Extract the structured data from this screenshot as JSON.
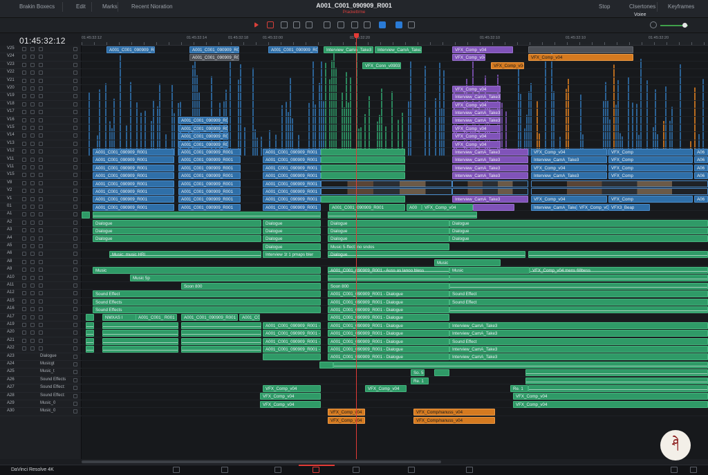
{
  "window": {
    "menu": [
      "Brakin Boxecs",
      "Edit",
      "Marks",
      "Recent Nioration"
    ],
    "title": "A001_C001_090909_R001",
    "subtitle": "Prackettrme",
    "right_menu": [
      "Stop",
      "Clsertones",
      "Keyframes"
    ],
    "right_label": "Voiee"
  },
  "timecode": "01:45:32:12",
  "ruler_labels": [
    "01:45:32:12",
    "01:45:32:14",
    "01:45:32:18",
    "01:45:32:00",
    "01:45:32:20",
    "01:45:32:10",
    "01:45:32:10",
    "01:45:32:20"
  ],
  "tracks": [
    {
      "name": "V25",
      "label": ""
    },
    {
      "name": "V24",
      "label": ""
    },
    {
      "name": "V23",
      "label": ""
    },
    {
      "name": "V22",
      "label": ""
    },
    {
      "name": "V21",
      "label": ""
    },
    {
      "name": "V20",
      "label": ""
    },
    {
      "name": "V19",
      "label": ""
    },
    {
      "name": "V18",
      "label": ""
    },
    {
      "name": "V17",
      "label": ""
    },
    {
      "name": "V16",
      "label": ""
    },
    {
      "name": "V15",
      "label": ""
    },
    {
      "name": "V14",
      "label": ""
    },
    {
      "name": "V13",
      "label": ""
    },
    {
      "name": "V12",
      "label": ""
    },
    {
      "name": "V11",
      "label": ""
    },
    {
      "name": "V11",
      "label": ""
    },
    {
      "name": "V15",
      "label": ""
    },
    {
      "name": "V8",
      "label": ""
    },
    {
      "name": "V2",
      "label": ""
    },
    {
      "name": "V1",
      "label": ""
    },
    {
      "name": "01",
      "label": ""
    },
    {
      "name": "A1",
      "label": ""
    },
    {
      "name": "A2",
      "label": ""
    },
    {
      "name": "A3",
      "label": ""
    },
    {
      "name": "A4",
      "label": ""
    },
    {
      "name": "A5",
      "label": ""
    },
    {
      "name": "A6",
      "label": ""
    },
    {
      "name": "A8",
      "label": ""
    },
    {
      "name": "A9",
      "label": ""
    },
    {
      "name": "A10",
      "label": ""
    },
    {
      "name": "A11",
      "label": ""
    },
    {
      "name": "A12",
      "label": ""
    },
    {
      "name": "A15",
      "label": ""
    },
    {
      "name": "A16",
      "label": ""
    },
    {
      "name": "A17",
      "label": ""
    },
    {
      "name": "A19",
      "label": ""
    },
    {
      "name": "A20",
      "label": ""
    },
    {
      "name": "A21",
      "label": ""
    },
    {
      "name": "A22",
      "label": ""
    },
    {
      "name": "A23",
      "label": "Dialogue"
    },
    {
      "name": "A24",
      "label": "Musicgt"
    },
    {
      "name": "A25",
      "label": "Music_t"
    },
    {
      "name": "A26",
      "label": "Sound Effects"
    },
    {
      "name": "A27",
      "label": "Sound Effect:"
    },
    {
      "name": "A28",
      "label": "Sound Effect:"
    },
    {
      "name": "A29",
      "label": "Music_0"
    },
    {
      "name": "A30",
      "label": "Music_0"
    }
  ],
  "clips": {
    "v25": [
      "A001_C001_090909_R001",
      "A001_C001_090909_R001",
      "A001_C001_090909_R001",
      "Interview_CamA_Take3",
      "Interview_CamA_Take3",
      "VFX_Comp_v04"
    ],
    "v24": [
      "A001_C001_090909_R001",
      "VFX_Comp_v04",
      "VFX_Comp_v04"
    ],
    "v23": [
      "VFX_Conn_v0903",
      "VFX_Comp_v04"
    ],
    "v20_stack": [
      "VFX_Comp_v04",
      "Interview_CamA_Take3",
      "VFX_Comp_v04",
      "Interview_CamA_Take3",
      "Interview_CamA_Take3",
      "VFX_Comp_v04",
      "VFX_Comp_v04",
      "VFX_Comp_v04"
    ],
    "mid_video": "A001_C001_090909_R001",
    "vfx_comp": "VFX_Comp_v04",
    "interview": "Interview_CamA_Take3",
    "vfx_short": "VFX_Comp",
    "a06": "A06",
    "v1_tail": [
      "A001_C001_090909_R001",
      "A001_C001_090909_R001",
      "A001_C001_090909_R001",
      "A001_C001_090909_R001",
      "A00",
      "VFX_Comp_v04",
      "Interview_CamA_Take3",
      "VFX_Comp_v04",
      "VFX3_Beap"
    ],
    "audio": {
      "dialogue": "Dialogue",
      "music": "Music",
      "music_sp": "Music 5p",
      "music_hdr": "Music: music HRI",
      "interview_track": "Interview 1t 1 pmaps bler",
      "music_sfx": "Music 5-ffect: no sndos",
      "sound_effect": "Sound Effect",
      "sound_effects": "Sound Effects",
      "soon": "Soon 800",
      "soon2": "Soon 800",
      "a001_dialogue": "A001_C001_090909_R001 - Dialogue",
      "a001_long": "A001_C001_090909_R001 - ",
      "a001_ausc": "A001_C001_090909_R001 - Auss as lanoo bless",
      "vfx_interview": "VFX_Comp_v04 mens 68bess",
      "nmxx": "NMXAS I",
      "a001_s": "A001_C001_ R001",
      "a001_b": "A001_C001_090909_R001",
      "a001_short": "A001_C00",
      "so": "So. 5",
      "re": "Re. 1",
      "vfx_comp_v04": "VFX_Comp_v04",
      "vfx_comp_long": "VFX_Comp/nanuss_v04"
    }
  },
  "bottom": {
    "brand": "DaVinci Resolve 4K"
  },
  "colors": {
    "video": "#2f6fa8",
    "audio": "#2f9a67",
    "purple": "#8053b9",
    "orange": "#d57a20",
    "playhead": "#e23b36"
  },
  "logo_text": "ཤེ"
}
